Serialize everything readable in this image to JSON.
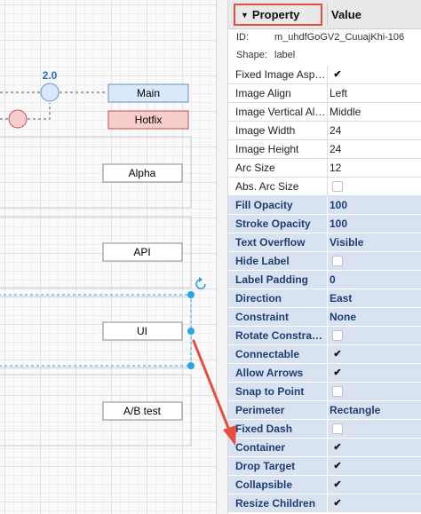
{
  "canvas": {
    "version_label": "2.0",
    "branch_main": "Main",
    "branch_hotfix": "Hotfix",
    "lanes": [
      "Alpha",
      "API",
      "UI",
      "A/B test"
    ]
  },
  "panel": {
    "header": {
      "property": "Property",
      "value": "Value"
    },
    "id_label": "ID:",
    "id_value": "m_uhdfGoGV2_CuuajKhi-106",
    "shape_label": "Shape:",
    "shape_value": "label",
    "rows": [
      {
        "name": "Fixed Image Asp…",
        "type": "checkbox",
        "checked": true,
        "highlight": false
      },
      {
        "name": "Image Align",
        "type": "text",
        "value": "Left",
        "highlight": false
      },
      {
        "name": "Image Vertical Al…",
        "type": "text",
        "value": "Middle",
        "highlight": false
      },
      {
        "name": "Image Width",
        "type": "text",
        "value": "24",
        "highlight": false
      },
      {
        "name": "Image Height",
        "type": "text",
        "value": "24",
        "highlight": false
      },
      {
        "name": "Arc Size",
        "type": "text",
        "value": "12",
        "highlight": false
      },
      {
        "name": "Abs. Arc Size",
        "type": "checkbox",
        "checked": false,
        "highlight": false
      },
      {
        "name": "Fill Opacity",
        "type": "text",
        "value": "100",
        "highlight": true
      },
      {
        "name": "Stroke Opacity",
        "type": "text",
        "value": "100",
        "highlight": true
      },
      {
        "name": "Text Overflow",
        "type": "text",
        "value": "Visible",
        "highlight": true
      },
      {
        "name": "Hide Label",
        "type": "checkbox",
        "checked": false,
        "highlight": true
      },
      {
        "name": "Label Padding",
        "type": "text",
        "value": "0",
        "highlight": true
      },
      {
        "name": "Direction",
        "type": "text",
        "value": "East",
        "highlight": true
      },
      {
        "name": "Constraint",
        "type": "text",
        "value": "None",
        "highlight": true
      },
      {
        "name": "Rotate Constra…",
        "type": "checkbox",
        "checked": false,
        "highlight": true
      },
      {
        "name": "Connectable",
        "type": "checkbox",
        "checked": true,
        "highlight": true
      },
      {
        "name": "Allow Arrows",
        "type": "checkbox",
        "checked": true,
        "highlight": true
      },
      {
        "name": "Snap to Point",
        "type": "checkbox",
        "checked": false,
        "highlight": true
      },
      {
        "name": "Perimeter",
        "type": "text",
        "value": "Rectangle",
        "highlight": true
      },
      {
        "name": "Fixed Dash",
        "type": "checkbox",
        "checked": false,
        "highlight": true
      },
      {
        "name": "Container",
        "type": "checkbox",
        "checked": true,
        "highlight": true
      },
      {
        "name": "Drop Target",
        "type": "checkbox",
        "checked": true,
        "highlight": true
      },
      {
        "name": "Collapsible",
        "type": "checkbox",
        "checked": true,
        "highlight": true
      },
      {
        "name": "Resize Children",
        "type": "checkbox",
        "checked": true,
        "highlight": true
      }
    ]
  },
  "colors": {
    "highlight_row": "#d9e2f1",
    "highlight_text": "#1f3d74",
    "annotation": "#e74c3c",
    "selection": "#29a3ea"
  },
  "icons": {
    "checkbox_on": "checkmark-icon",
    "collapse": "triangle-down-icon",
    "rotate": "rotate-icon"
  }
}
